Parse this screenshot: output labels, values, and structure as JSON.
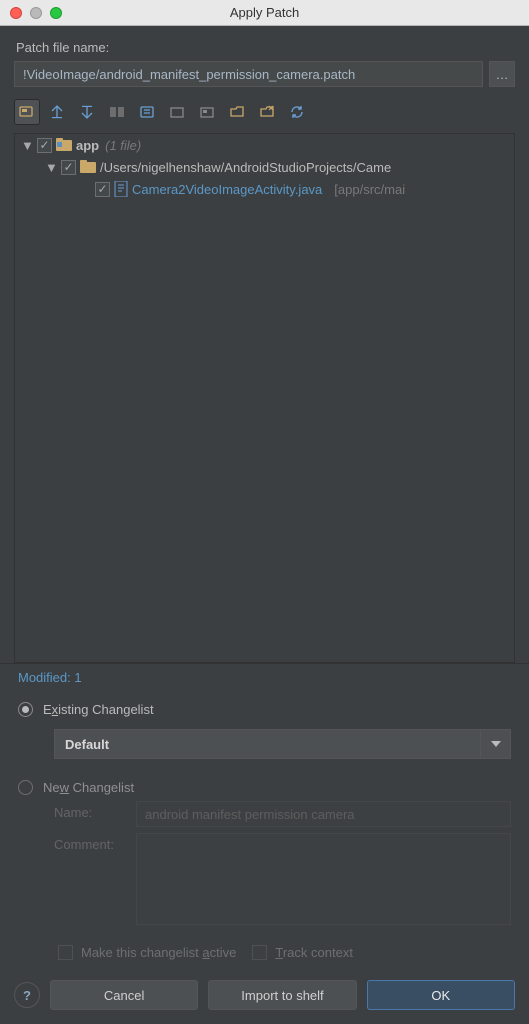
{
  "window": {
    "title": "Apply Patch"
  },
  "patch": {
    "label": "Patch file name:",
    "value": "!VideoImage/android_manifest_permission_camera.patch"
  },
  "tree": {
    "root": {
      "name": "app",
      "file_count": "(1 file)"
    },
    "project": {
      "path": "/Users/nigelhenshaw/AndroidStudioProjects/Came"
    },
    "file": {
      "name": "Camera2VideoImageActivity.java",
      "location": "[app/src/mai"
    }
  },
  "modified": {
    "label": "Modified: 1"
  },
  "changelist": {
    "existing": {
      "label_pre": "E",
      "label_u": "x",
      "label_post": "isting Changelist",
      "selected": "Default"
    },
    "new_": {
      "label_pre": "Ne",
      "label_u": "w",
      "label_post": " Changelist"
    },
    "name_label": "Name:",
    "name_placeholder": "android manifest permission camera",
    "comment_label": "Comment:",
    "make_active": {
      "pre": "Make this changelist ",
      "u": "a",
      "post": "ctive"
    },
    "track": {
      "u": "T",
      "post": "rack context"
    }
  },
  "buttons": {
    "cancel": "Cancel",
    "import": "Import to shelf",
    "ok": "OK"
  }
}
